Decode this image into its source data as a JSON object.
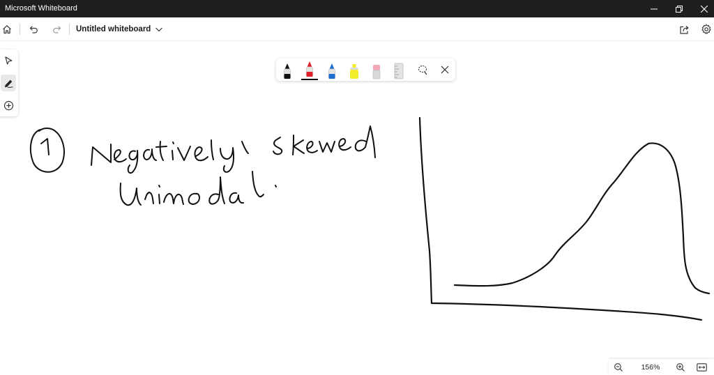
{
  "window": {
    "title": "Microsoft Whiteboard",
    "controls": [
      "minimize-icon",
      "restore-icon",
      "close-icon"
    ]
  },
  "toolbar": {
    "board_title": "Untitled whiteboard",
    "left_icons": [
      "home-icon",
      "undo-icon",
      "redo-icon",
      "chevron-down-icon"
    ],
    "right_icons": [
      "share-icon",
      "gear-icon"
    ]
  },
  "side_rail": {
    "tools": [
      "select-pointer-icon",
      "inking-pen-icon",
      "add-content-icon"
    ],
    "active": "inking-pen-icon"
  },
  "pen_tray": {
    "pens": [
      {
        "name": "black-pen",
        "color": "#111111"
      },
      {
        "name": "red-pen",
        "color": "#e0202a",
        "selected": true
      },
      {
        "name": "blue-pen",
        "color": "#1f6fd0"
      },
      {
        "name": "yellow-highlighter",
        "color": "#f2ee2a"
      },
      {
        "name": "eraser",
        "color": "#f1a7b5"
      },
      {
        "name": "ruler",
        "color": "#cfcfcf"
      }
    ],
    "extra_tools": [
      "lasso-select-icon",
      "close-icon"
    ]
  },
  "canvas": {
    "handwriting": [
      "1",
      "Negatively Skewed",
      "Unimodal"
    ]
  },
  "zoom": {
    "level": "156%",
    "icons": [
      "zoom-out-icon",
      "zoom-in-icon",
      "fit-to-screen-icon"
    ]
  }
}
